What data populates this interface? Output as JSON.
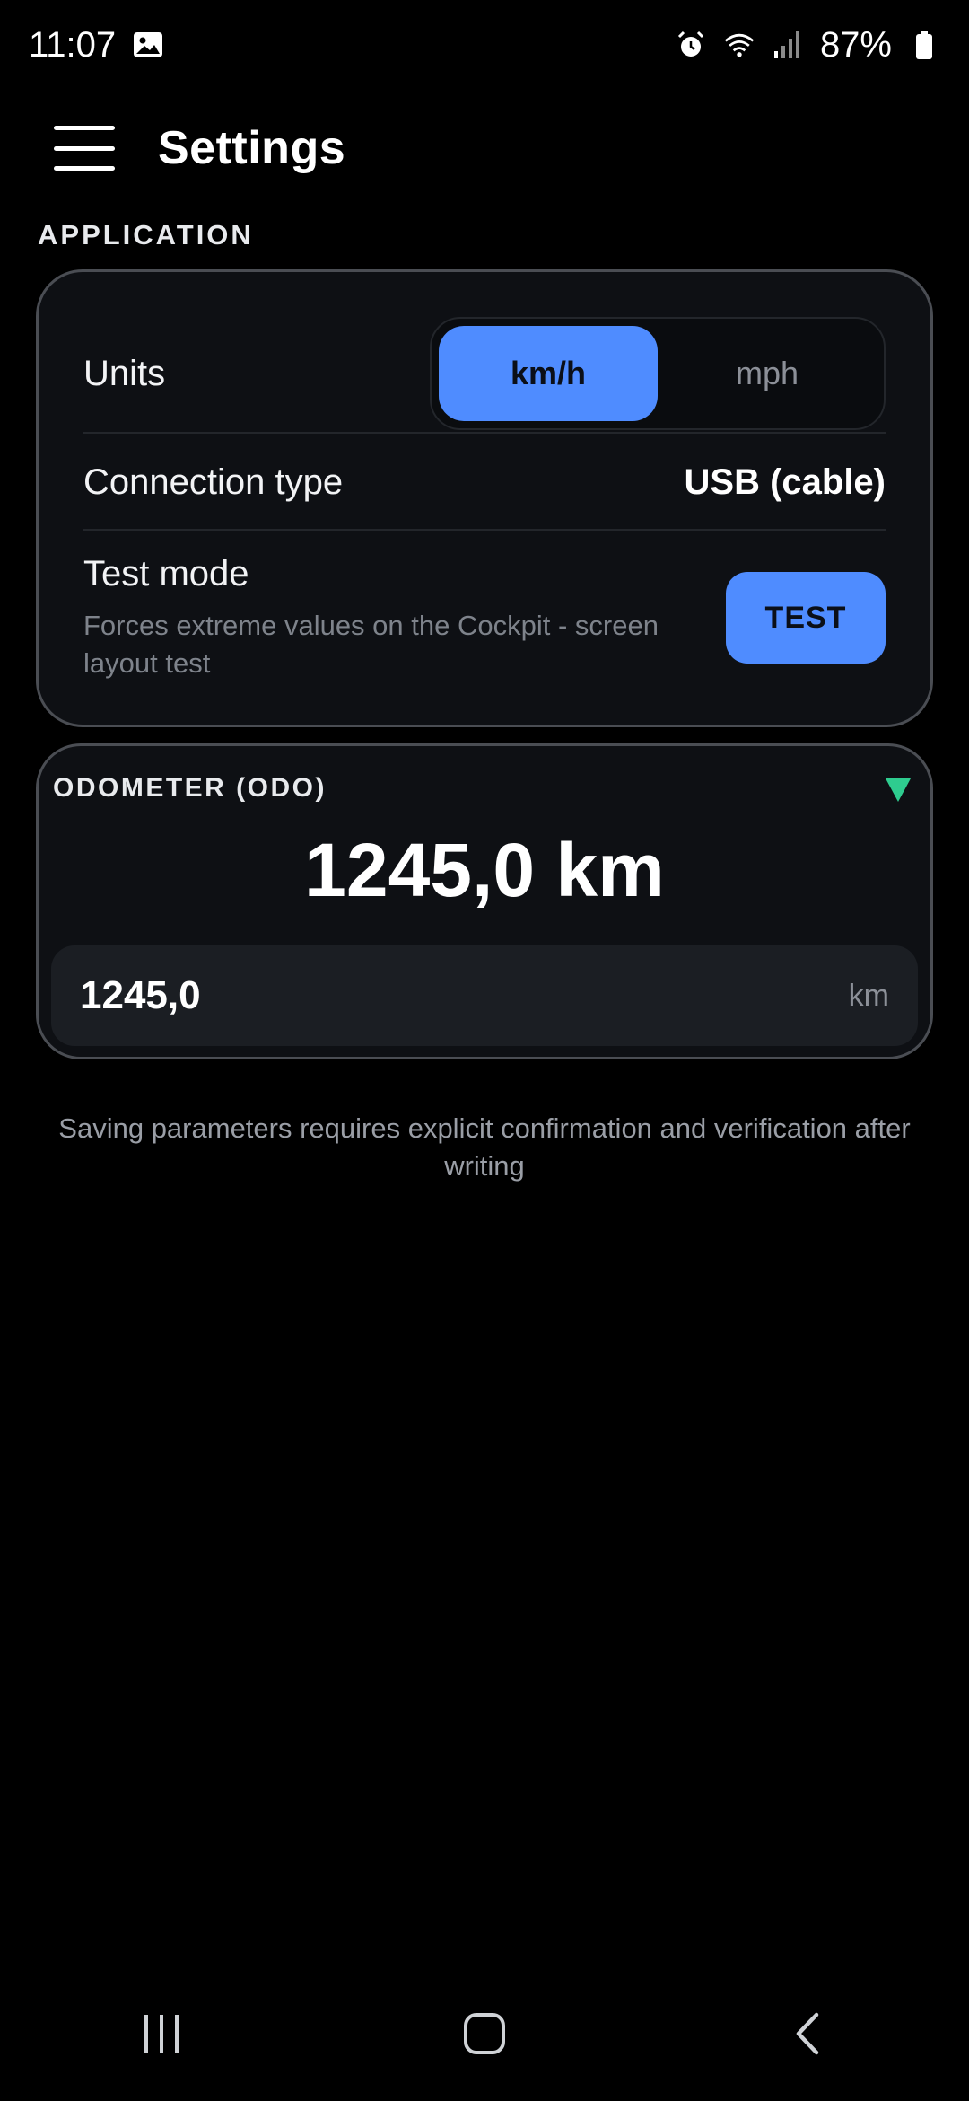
{
  "status_bar": {
    "time": "11:07",
    "battery": "87%",
    "icons": [
      "image-icon",
      "alarm-icon",
      "wifi-icon",
      "signal-icon",
      "battery-icon"
    ]
  },
  "header": {
    "title": "Settings",
    "menu_icon": "hamburger-menu-icon"
  },
  "application": {
    "section_label": "APPLICATION",
    "units": {
      "label": "Units",
      "options": [
        "km/h",
        "mph"
      ],
      "selected": "km/h"
    },
    "connection": {
      "label": "Connection type",
      "value": "USB (cable)"
    },
    "test_mode": {
      "title": "Test mode",
      "description": "Forces extreme values on the Cockpit - screen layout test",
      "button_label": "TEST"
    }
  },
  "odometer": {
    "label": "ODOMETER (ODO)",
    "display_value": "1245,0 km",
    "input_value": "1245,0",
    "unit": "km",
    "toggle_icon": "triangle-down-icon"
  },
  "footer_note": "Saving parameters requires explicit confirmation and verification after writing",
  "nav_bar": {
    "icons": [
      "recent-apps-icon",
      "home-icon",
      "back-icon"
    ]
  },
  "colors": {
    "accent": "#4f8cff",
    "odo_toggle": "#2ecc8f",
    "card_bg": "#0e1014",
    "card_border": "#4a4d53"
  }
}
